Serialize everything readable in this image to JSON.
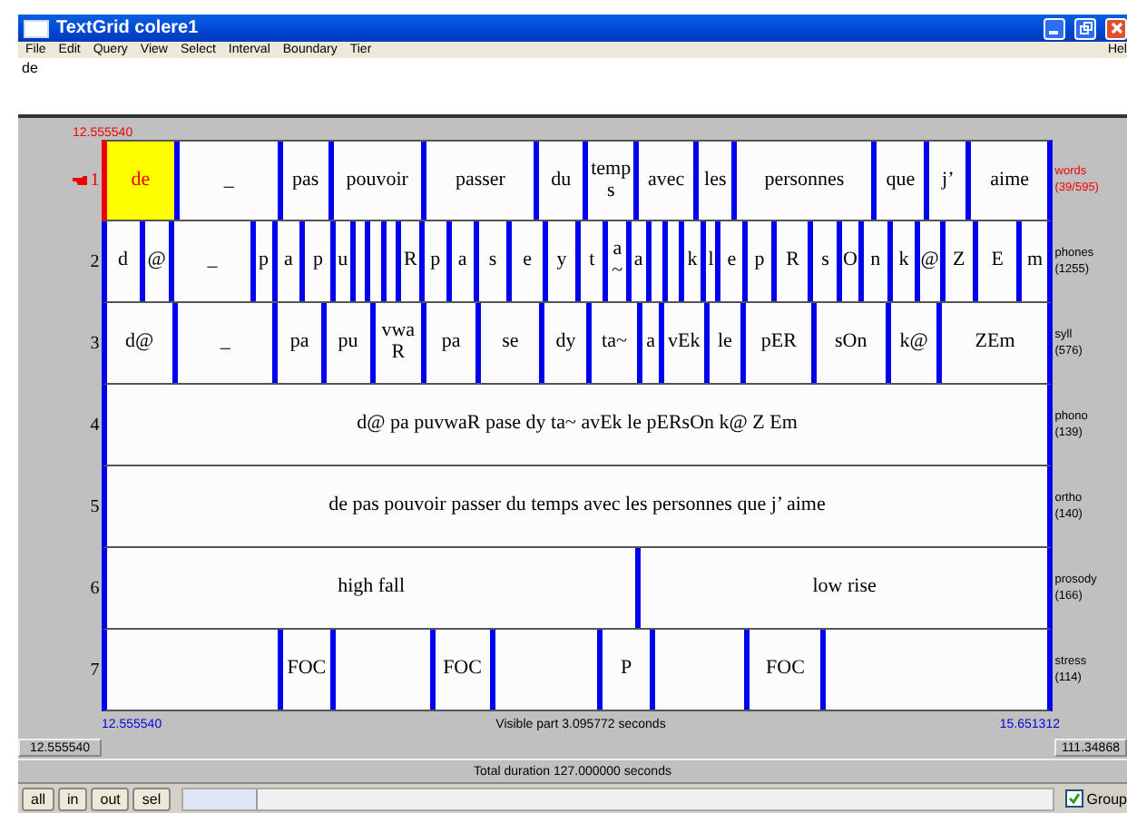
{
  "window": {
    "title": "TextGrid colere1"
  },
  "menu": [
    "File",
    "Edit",
    "Query",
    "View",
    "Select",
    "Interval",
    "Boundary",
    "Tier",
    "Hel"
  ],
  "text_field": {
    "value": "de"
  },
  "cursor_time": "12.555540",
  "tiers": [
    {
      "number": "1",
      "name": "words",
      "count": "(39/595)",
      "selected": true,
      "kind": "interval",
      "intervals": [
        {
          "text": "de",
          "selected": true
        },
        {
          "text": "_",
          "selected": false
        },
        {
          "text": "pas",
          "selected": false
        },
        {
          "text": "pouvoir",
          "selected": false
        },
        {
          "text": "passer",
          "selected": false
        },
        {
          "text": "du",
          "selected": false
        },
        {
          "text": "temps",
          "selected": false
        },
        {
          "text": "avec",
          "selected": false
        },
        {
          "text": "les",
          "selected": false
        },
        {
          "text": "personnes",
          "selected": false
        },
        {
          "text": "que",
          "selected": false
        },
        {
          "text": "j’",
          "selected": false
        },
        {
          "text": "aime",
          "selected": false
        }
      ]
    },
    {
      "number": "2",
      "name": "phones",
      "count": "(1255)",
      "selected": false,
      "kind": "interval",
      "intervals": [
        {
          "text": "d",
          "selected": false
        },
        {
          "text": "@",
          "selected": false
        },
        {
          "text": "_",
          "selected": false
        },
        {
          "text": "p",
          "selected": false
        },
        {
          "text": "a",
          "selected": false
        },
        {
          "text": "p",
          "selected": false
        },
        {
          "text": "u",
          "selected": false
        },
        {
          "selected": false
        },
        {
          "selected": false
        },
        {
          "selected": false
        },
        {
          "text": "R",
          "selected": false
        },
        {
          "text": "p",
          "selected": false
        },
        {
          "text": "a",
          "selected": false
        },
        {
          "text": "s",
          "selected": false
        },
        {
          "text": "e",
          "selected": false
        },
        {
          "text": "y",
          "selected": false
        },
        {
          "text": "t",
          "selected": false
        },
        {
          "text": "a~",
          "selected": false
        },
        {
          "text": "a",
          "selected": false
        },
        {
          "selected": false
        },
        {
          "selected": false
        },
        {
          "text": "k",
          "selected": false
        },
        {
          "text": "l",
          "selected": false
        },
        {
          "text": "e",
          "selected": false
        },
        {
          "text": "p",
          "selected": false
        },
        {
          "text": "R",
          "selected": false
        },
        {
          "text": "s",
          "selected": false
        },
        {
          "text": "O",
          "selected": false
        },
        {
          "text": "n",
          "selected": false
        },
        {
          "text": "k",
          "selected": false
        },
        {
          "text": "@",
          "selected": false
        },
        {
          "text": "Z",
          "selected": false
        },
        {
          "text": "E",
          "selected": false
        },
        {
          "text": "m",
          "selected": false
        }
      ]
    },
    {
      "number": "3",
      "name": "syll",
      "count": "(576)",
      "selected": false,
      "kind": "interval",
      "intervals": [
        {
          "text": "d@",
          "selected": false
        },
        {
          "text": "_",
          "selected": false
        },
        {
          "text": "pa",
          "selected": false
        },
        {
          "text": "pu",
          "selected": false
        },
        {
          "text": "vwaR",
          "selected": false
        },
        {
          "text": "pa",
          "selected": false
        },
        {
          "text": "se",
          "selected": false
        },
        {
          "text": "dy",
          "selected": false
        },
        {
          "text": "ta~",
          "selected": false
        },
        {
          "text": "a",
          "selected": false
        },
        {
          "text": "vEk",
          "selected": false
        },
        {
          "text": "le",
          "selected": false
        },
        {
          "text": "pER",
          "selected": false
        },
        {
          "text": "sOn",
          "selected": false
        },
        {
          "text": "k@",
          "selected": false
        },
        {
          "text": "ZEm",
          "selected": false
        }
      ]
    },
    {
      "number": "4",
      "name": "phono",
      "count": "(139)",
      "selected": false,
      "kind": "interval",
      "intervals": [
        {
          "text": "d@ pa puvwaR pase dy ta~ avEk le pERsOn k@ Z Em",
          "selected": false
        }
      ]
    },
    {
      "number": "5",
      "name": "ortho",
      "count": "(140)",
      "selected": false,
      "kind": "interval",
      "intervals": [
        {
          "text": "de pas pouvoir passer du temps avec les personnes que j’ aime",
          "selected": false
        }
      ]
    },
    {
      "number": "6",
      "name": "prosody",
      "count": "(166)",
      "selected": false,
      "kind": "interval",
      "intervals": [
        {
          "text": "high fall",
          "selected": false
        },
        {
          "text": "low rise",
          "selected": false
        }
      ]
    },
    {
      "number": "7",
      "name": "stress",
      "count": "(114)",
      "selected": false,
      "kind": "interval",
      "intervals": [
        {
          "selected": false
        },
        {
          "text": "FOC",
          "selected": false
        },
        {
          "selected": false
        },
        {
          "text": "FOC",
          "selected": false
        },
        {
          "selected": false
        },
        {
          "text": "P",
          "selected": false
        },
        {
          "selected": false
        },
        {
          "text": "FOC",
          "selected": false
        },
        {
          "selected": false
        }
      ]
    }
  ],
  "visible": {
    "start": "12.555540",
    "label": "Visible part 3.095772 seconds",
    "end": "15.651312"
  },
  "window_start": "12.555540",
  "window_end": "111.34868",
  "total": "Total duration 127.000000 seconds",
  "buttons": [
    "all",
    "in",
    "out",
    "sel"
  ],
  "group": {
    "label": "Group",
    "checked": true
  }
}
